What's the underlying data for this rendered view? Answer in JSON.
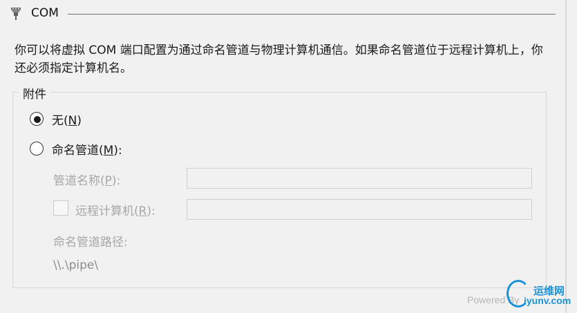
{
  "header": {
    "title": "COM",
    "icon": "com-port-icon"
  },
  "description": "你可以将虚拟 COM 端口配置为通过命名管道与物理计算机通信。如果命名管道位于远程计算机上，你还必须指定计算机名。",
  "attachment": {
    "group_label": "附件",
    "options": [
      {
        "label": "无",
        "hotkey": "N",
        "selected": true
      },
      {
        "label": "命名管道",
        "hotkey": "M",
        "selected": false
      }
    ],
    "pipe_name": {
      "label": "管道名称",
      "hotkey": "P",
      "value": ""
    },
    "remote_computer": {
      "label": "远程计算机",
      "hotkey": "R",
      "checked": false,
      "value": ""
    },
    "pipe_path": {
      "label": "命名管道路径:",
      "value": "\\\\.\\pipe\\"
    }
  },
  "watermark": {
    "powered_by": "Powered By",
    "brand_cn": "运维网",
    "brand_en": "iyunv.com"
  },
  "colors": {
    "background": "#f1f1f1",
    "disabled_text": "#a6a6a6",
    "brand": "#1a93d6"
  }
}
